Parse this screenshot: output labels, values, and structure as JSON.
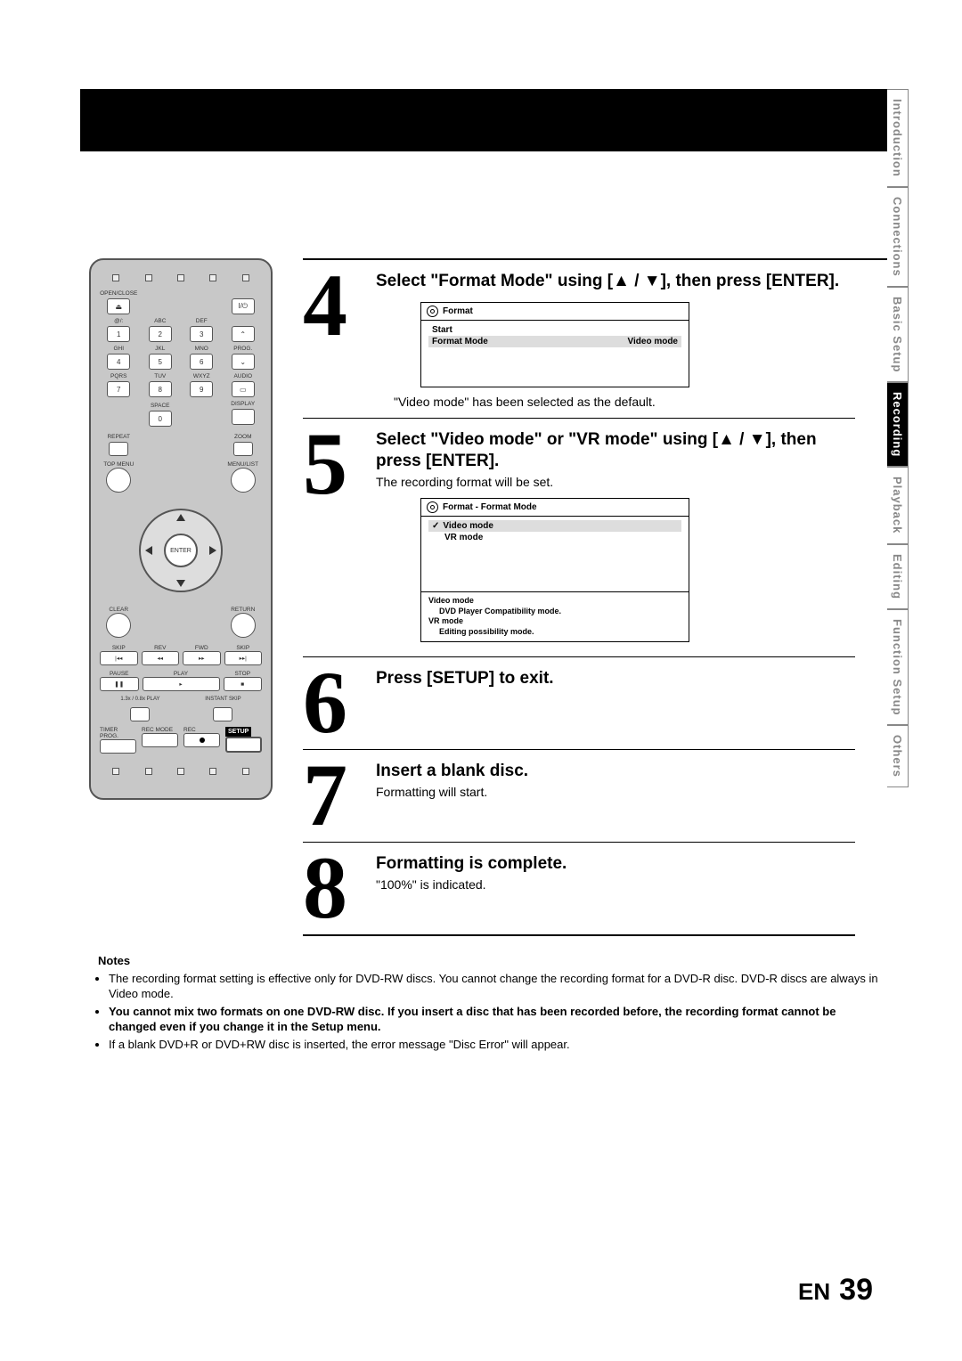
{
  "sideTabs": [
    "Introduction",
    "Connections",
    "Basic Setup",
    "Recording",
    "Playback",
    "Editing",
    "Function Setup",
    "Others"
  ],
  "activeTab": 3,
  "remote": {
    "openClose": "OPEN/CLOSE",
    "power": "I/⏻",
    "keypad": [
      [
        "@/:",
        "ABC",
        "DEF",
        ""
      ],
      [
        "1",
        "2",
        "3",
        "⌃"
      ],
      [
        "GHI",
        "JKL",
        "MNO",
        "PROG."
      ],
      [
        "4",
        "5",
        "6",
        "⌄"
      ],
      [
        "PQRS",
        "TUV",
        "WXYZ",
        "AUDIO"
      ],
      [
        "7",
        "8",
        "9",
        "▭"
      ],
      [
        "",
        "SPACE",
        "",
        "DISPLAY"
      ],
      [
        "",
        "0",
        "",
        ""
      ]
    ],
    "repeat": "REPEAT",
    "zoom": "ZOOM",
    "topMenu": "TOP MENU",
    "menuList": "MENU/LIST",
    "enter": "ENTER",
    "clear": "CLEAR",
    "return": "RETURN",
    "skip": "SKIP",
    "rev": "REV",
    "fwd": "FWD",
    "skip2": "SKIP",
    "pause": "PAUSE",
    "play": "PLAY",
    "stop": "STOP",
    "speedPlay": "1.3x / 0.8x PLAY",
    "instantSkip": "INSTANT SKIP",
    "timerProg": "TIMER PROG.",
    "recMode": "REC MODE",
    "rec": "REC",
    "setup": "SETUP"
  },
  "steps": {
    "s4": {
      "n": "4",
      "title_a": "Select \"Format Mode\" using [",
      "title_b": " / ",
      "title_c": "], then press [ENTER].",
      "osd_title": "Format",
      "osd_r1": "Start",
      "osd_r2_l": "Format Mode",
      "osd_r2_r": "Video mode",
      "caption": "\"Video mode\" has been selected as the default."
    },
    "s5": {
      "n": "5",
      "title_a": "Select \"Video mode\" or \"VR mode\"  using [",
      "title_b": " / ",
      "title_c": "], then press [ENTER].",
      "sub": "The recording format will be set.",
      "osd_title": "Format - Format Mode",
      "opt1": "Video mode",
      "opt2": "VR mode",
      "note1l": "Video mode",
      "note1": "DVD Player Compatibility mode.",
      "note2l": "VR mode",
      "note2": "Editing possibility mode."
    },
    "s6": {
      "n": "6",
      "title": "Press [SETUP] to exit."
    },
    "s7": {
      "n": "7",
      "title": "Insert a blank disc.",
      "sub": "Formatting will start."
    },
    "s8": {
      "n": "8",
      "title": "Formatting is complete.",
      "sub": "\"100%\" is indicated."
    }
  },
  "notes": {
    "hdr": "Notes",
    "items": [
      "The recording format setting is effective only for DVD-RW discs. You cannot change the recording format for a DVD-R disc. DVD-R discs are always in Video mode.",
      "You cannot mix two formats on one DVD-RW disc. If you insert a disc that has been recorded before, the recording format cannot be changed even if you change it in the Setup menu.",
      "If a blank DVD+R or DVD+RW disc is inserted, the error message \"Disc Error\" will appear."
    ]
  },
  "pageNum": {
    "lang": "EN",
    "num": "39"
  }
}
